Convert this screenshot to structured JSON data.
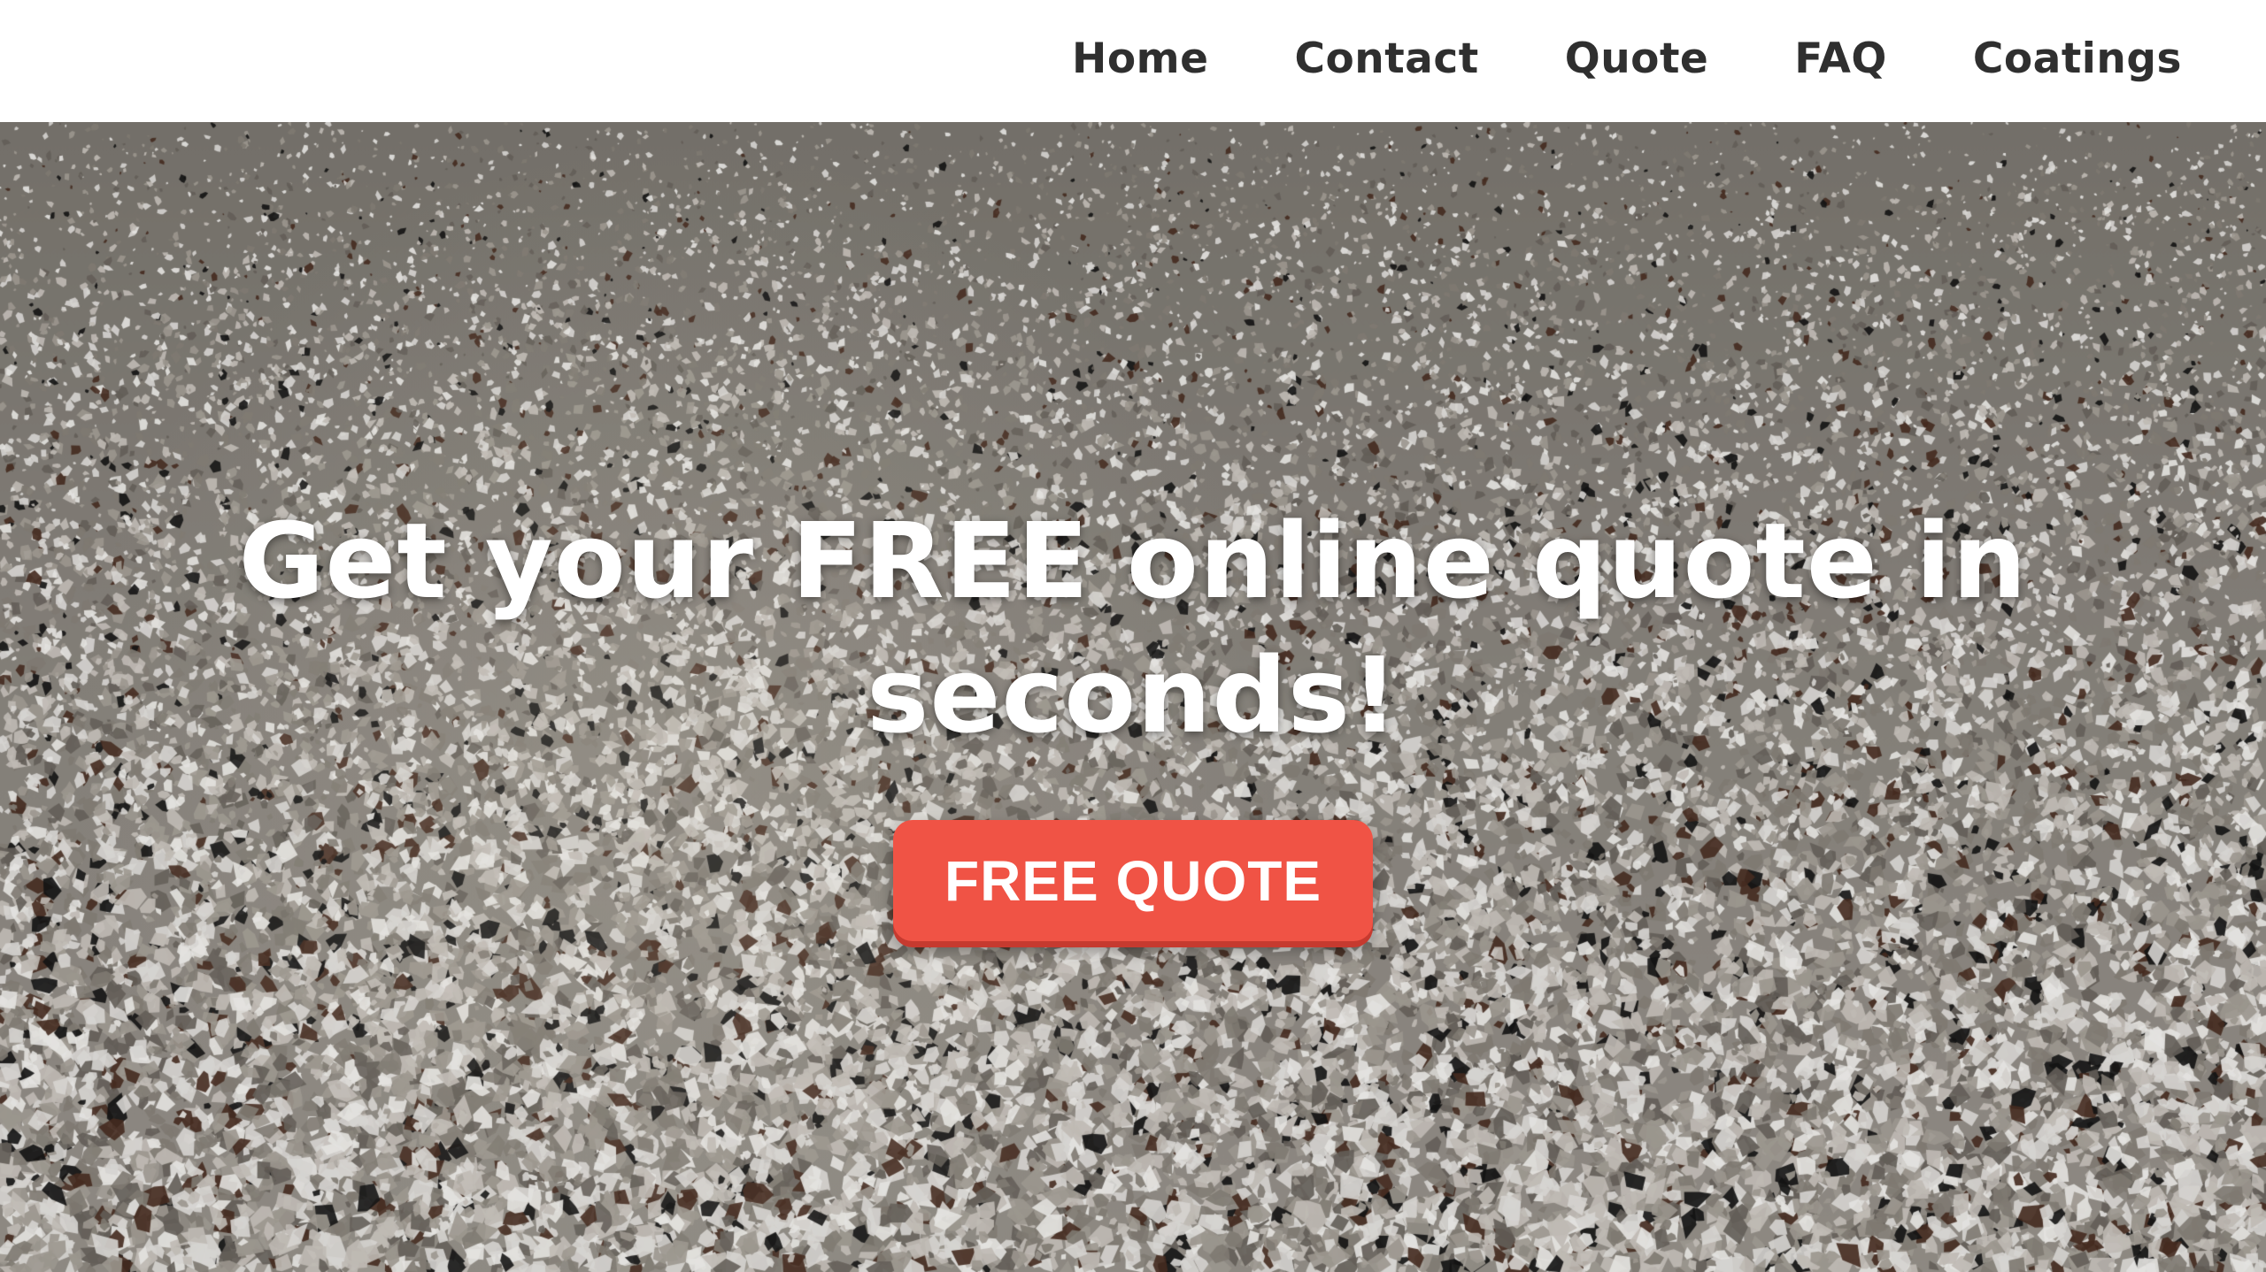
{
  "nav": {
    "items": [
      {
        "label": "Home"
      },
      {
        "label": "Contact"
      },
      {
        "label": "Quote"
      },
      {
        "label": "FAQ"
      },
      {
        "label": "Coatings"
      }
    ]
  },
  "hero": {
    "title_line1": "Get your FREE online quote in",
    "title_line2": "seconds!",
    "cta_label": "FREE QUOTE",
    "background": "epoxy-flake-floor-texture"
  },
  "colors": {
    "header_bg": "#ffffff",
    "nav_text": "#2f2f2f",
    "cta_bg": "#f05345",
    "hero_text": "#ffffff",
    "flake_colors": [
      "#e8e6e2",
      "#cfcac3",
      "#a9a39a",
      "#8a847b",
      "#6b665f",
      "#4a2f22",
      "#151515",
      "#f7f6f3"
    ]
  }
}
